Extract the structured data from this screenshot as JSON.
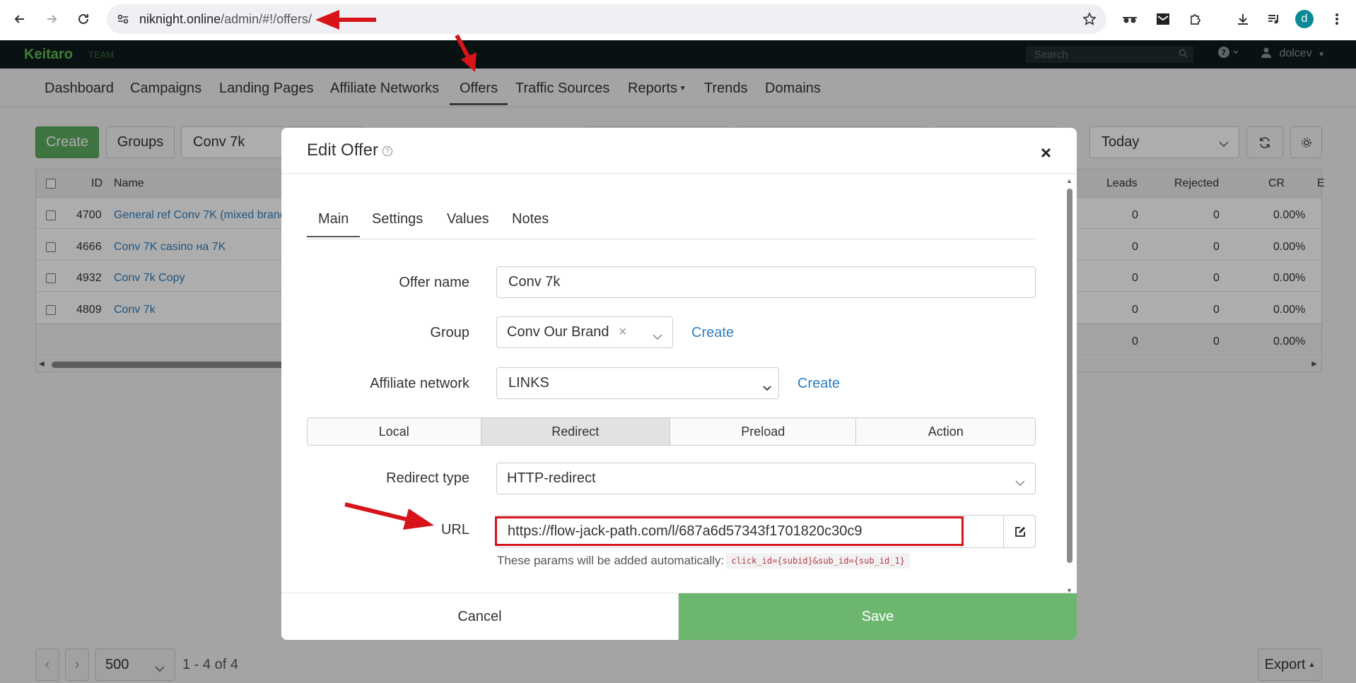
{
  "browser": {
    "url_host": "niknight.online",
    "url_path": "/admin/#!/offers/",
    "profile_initial": "d"
  },
  "app": {
    "brand": "Keitaro",
    "brand_sub": "TEAM",
    "search_placeholder": "Search",
    "user": "dolcev",
    "nav": [
      "Dashboard",
      "Campaigns",
      "Landing Pages",
      "Affiliate Networks",
      "Offers",
      "Traffic Sources",
      "Reports",
      "Trends",
      "Domains"
    ],
    "active_nav": "Offers"
  },
  "toolbar": {
    "create": "Create",
    "groups": "Groups",
    "search_value": "Conv 7k",
    "period": "Today"
  },
  "table": {
    "columns": [
      "ID",
      "Name",
      "Leads",
      "Rejected",
      "CR",
      "E"
    ],
    "rows": [
      {
        "id": "4700",
        "name": "General ref Conv 7K (mixed brand",
        "leads": "0",
        "rejected": "0",
        "cr": "0.00%"
      },
      {
        "id": "4666",
        "name": "Conv 7K casino на 7K",
        "leads": "0",
        "rejected": "0",
        "cr": "0.00%"
      },
      {
        "id": "4932",
        "name": "Conv 7k Copy",
        "leads": "0",
        "rejected": "0",
        "cr": "0.00%"
      },
      {
        "id": "4809",
        "name": "Conv 7k",
        "leads": "0",
        "rejected": "0",
        "cr": "0.00%"
      }
    ],
    "totals": {
      "leads": "0",
      "rejected": "0",
      "cr": "0.00%"
    }
  },
  "pagination": {
    "per_page": "500",
    "range": "1 - 4 of 4",
    "export": "Export"
  },
  "modal": {
    "title": "Edit Offer",
    "tabs": [
      "Main",
      "Settings",
      "Values",
      "Notes"
    ],
    "offer_name_label": "Offer name",
    "offer_name": "Conv 7k",
    "group_label": "Group",
    "group_value": "Conv Our Brand",
    "create_link": "Create",
    "network_label": "Affiliate network",
    "network_value": "LINKS",
    "modes": [
      "Local",
      "Redirect",
      "Preload",
      "Action"
    ],
    "active_mode": "Redirect",
    "redirect_type_label": "Redirect type",
    "redirect_type": "HTTP-redirect",
    "url_label": "URL",
    "url_value": "https://flow-jack-path.com/l/687a6d57343f1701820c30c9",
    "hint": "These params will be added automatically:",
    "hint_code": "click_id={subid}&sub_id={sub_id_1}",
    "cancel": "Cancel",
    "save": "Save"
  },
  "colors": {
    "annotation_red": "#d6141a",
    "save_green": "#6cb66e",
    "brand_green": "#5bbd4e"
  }
}
